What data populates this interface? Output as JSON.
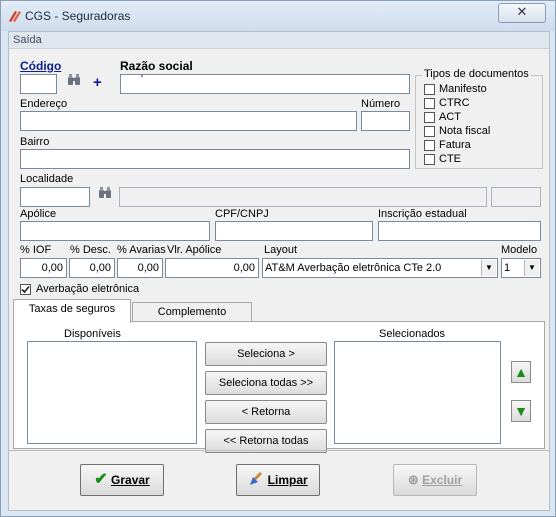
{
  "window": {
    "title": "CGS - Seguradoras",
    "close_glyph": "✕"
  },
  "menu": {
    "exit": "Saída"
  },
  "fields": {
    "codigo_label": "Código",
    "razao_label": "Razão social",
    "razao_value": "'",
    "endereco_label": "Endereço",
    "numero_label": "Número",
    "bairro_label": "Bairro",
    "localidade_label": "Localidade",
    "apolice_label": "Apólice",
    "cpf_label": "CPF/CNPJ",
    "inscricao_label": "Inscrição estadual",
    "iof_label": "% IOF",
    "desc_label": "% Desc.",
    "avarias_label": "% Avarias",
    "vlr_label": "Vlr. Apólice",
    "layout_label": "Layout",
    "modelo_label": "Modelo",
    "iof_value": "0,00",
    "desc_value": "0,00",
    "avarias_value": "0,00",
    "vlr_value": "0,00",
    "layout_value": "AT&M Averbação eletrônica CTe 2.0",
    "modelo_value": "1",
    "averbacao_label": "Averbação eletrônica",
    "averbacao_checked": true
  },
  "tipos": {
    "title": "Tipos de documentos",
    "items": [
      "Manifesto",
      "CTRC",
      "ACT",
      "Nota fiscal",
      "Fatura",
      "CTE"
    ]
  },
  "tabs": {
    "taxas": "Taxas de seguros",
    "complemento": "Complemento"
  },
  "lists": {
    "disponiveis": "Disponíveis",
    "selecionados": "Selecionados"
  },
  "buttons": {
    "seleciona": "Seleciona >",
    "seleciona_todas": "Seleciona todas >>",
    "retorna": "< Retorna",
    "retorna_todas": "<< Retorna todas",
    "gravar": "Gravar",
    "limpar": "Limpar",
    "excluir": "Excluir"
  },
  "colors": {
    "accent_blue": "#0a1f8c",
    "arrow_green": "#1a8a1a"
  },
  "icons": [
    "app-icon",
    "close-icon",
    "binoculars-icon",
    "plus-icon",
    "arrow-up-icon",
    "arrow-down-icon",
    "checkmark-icon",
    "broom-icon",
    "delete-icon"
  ]
}
